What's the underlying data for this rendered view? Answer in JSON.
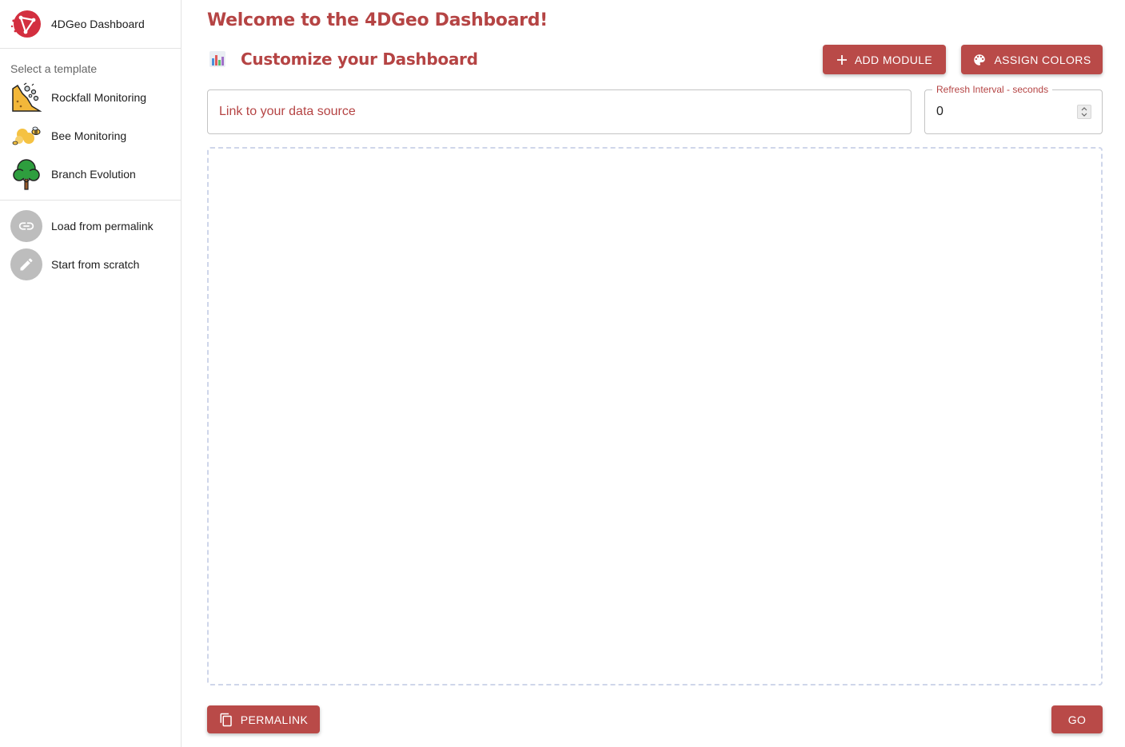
{
  "sidebar": {
    "brand": {
      "title": "4DGeo Dashboard",
      "icon": "4dgeo-logo-icon"
    },
    "section_label": "Select a template",
    "templates": [
      {
        "label": "Rockfall Monitoring",
        "icon": "rockfall-icon"
      },
      {
        "label": "Bee Monitoring",
        "icon": "bee-icon"
      },
      {
        "label": "Branch Evolution",
        "icon": "tree-icon"
      }
    ],
    "actions": [
      {
        "label": "Load from permalink",
        "icon": "link-icon"
      },
      {
        "label": "Start from scratch",
        "icon": "pencil-icon"
      }
    ]
  },
  "main": {
    "welcome": "Welcome to the 4DGeo Dashboard!",
    "subtitle": "Customize your Dashboard",
    "add_module_label": "ADD MODULE",
    "assign_colors_label": "ASSIGN COLORS",
    "source": {
      "placeholder": "Link to your data source",
      "value": ""
    },
    "refresh": {
      "label": "Refresh Interval - seconds",
      "value": "0"
    },
    "permalink_label": "PERMALINK",
    "go_label": "GO"
  },
  "colors": {
    "accent": "#b94a48",
    "title": "#b54444",
    "dropzone_border": "#cfd6ea"
  }
}
